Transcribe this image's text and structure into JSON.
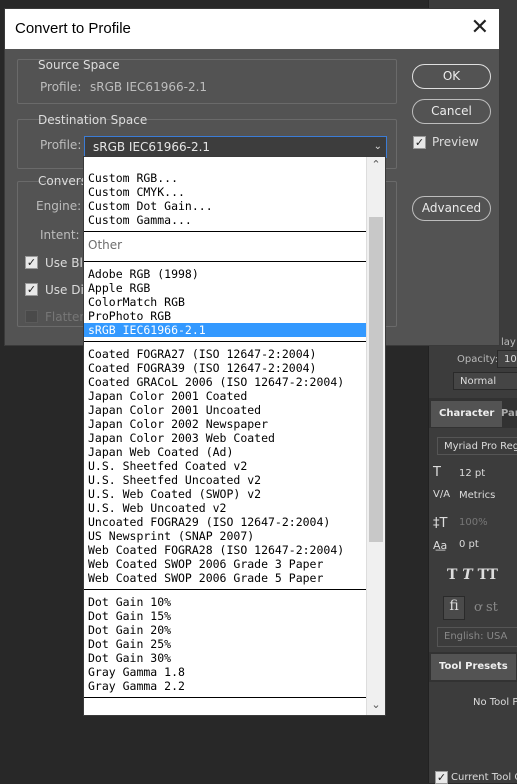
{
  "dialog": {
    "title": "Convert to Profile",
    "close_glyph": "✕",
    "source": {
      "heading": "Source Space",
      "profile_label": "Profile:",
      "profile_value": "sRGB IEC61966-2.1"
    },
    "destination": {
      "heading": "Destination Space",
      "profile_label": "Profile:",
      "profile_value": "sRGB IEC61966-2.1"
    },
    "conversion": {
      "heading": "Conversi",
      "engine_label": "Engine:",
      "intent_label": "Intent:",
      "use_black_label": "Use Bla",
      "use_dither_label": "Use Dit",
      "flatten_label": "Flatten"
    },
    "buttons": {
      "ok": "OK",
      "cancel": "Cancel",
      "advanced": "Advanced"
    },
    "preview_label": "Preview"
  },
  "dropdown": {
    "custom": [
      "Custom RGB...",
      "Custom CMYK...",
      "Custom Dot Gain...",
      "Custom Gamma..."
    ],
    "other_header": "Other",
    "rgb": [
      "Adobe RGB (1998)",
      "Apple RGB",
      "ColorMatch RGB",
      "ProPhoto RGB",
      "sRGB IEC61966-2.1"
    ],
    "cmyk": [
      "Coated FOGRA27 (ISO 12647-2:2004)",
      "Coated FOGRA39 (ISO 12647-2:2004)",
      "Coated GRACoL 2006 (ISO 12647-2:2004)",
      "Japan Color 2001 Coated",
      "Japan Color 2001 Uncoated",
      "Japan Color 2002 Newspaper",
      "Japan Color 2003 Web Coated",
      "Japan Web Coated (Ad)",
      "U.S. Sheetfed Coated v2",
      "U.S. Sheetfed Uncoated v2",
      "U.S. Web Coated (SWOP) v2",
      "U.S. Web Uncoated v2",
      "Uncoated FOGRA29 (ISO 12647-2:2004)",
      "US Newsprint (SNAP 2007)",
      "Web Coated FOGRA28 (ISO 12647-2:2004)",
      "Web Coated SWOP 2006 Grade 3 Paper",
      "Web Coated SWOP 2006 Grade 5 Paper"
    ],
    "gray": [
      "Dot Gain 10%",
      "Dot Gain 15%",
      "Dot Gain 20%",
      "Dot Gain 25%",
      "Dot Gain 30%",
      "Gray Gamma 1.8",
      "Gray Gamma 2.2"
    ],
    "selected": "sRGB IEC61966-2.1"
  },
  "right_panel": {
    "blend_fragment": "lay",
    "opacity_label": "Opacity:",
    "opacity_value": "100",
    "blend_mode": "Normal",
    "tabs": {
      "character": "Character",
      "paragraph": "Par"
    },
    "font_family": "Myriad Pro Regu",
    "font_size": "12 pt",
    "kerning": "Metrics",
    "vertical_scale": "100%",
    "baseline_shift": "0 pt",
    "language": "English: USA",
    "tool_presets_tab": "Tool Presets",
    "no_tool_presets": "No Tool Pr",
    "current_tool_label": "Current Tool O"
  },
  "colors": {
    "selection": "#3399ff",
    "dialog_bg": "#535353",
    "focus_border": "#3b7cd6"
  }
}
